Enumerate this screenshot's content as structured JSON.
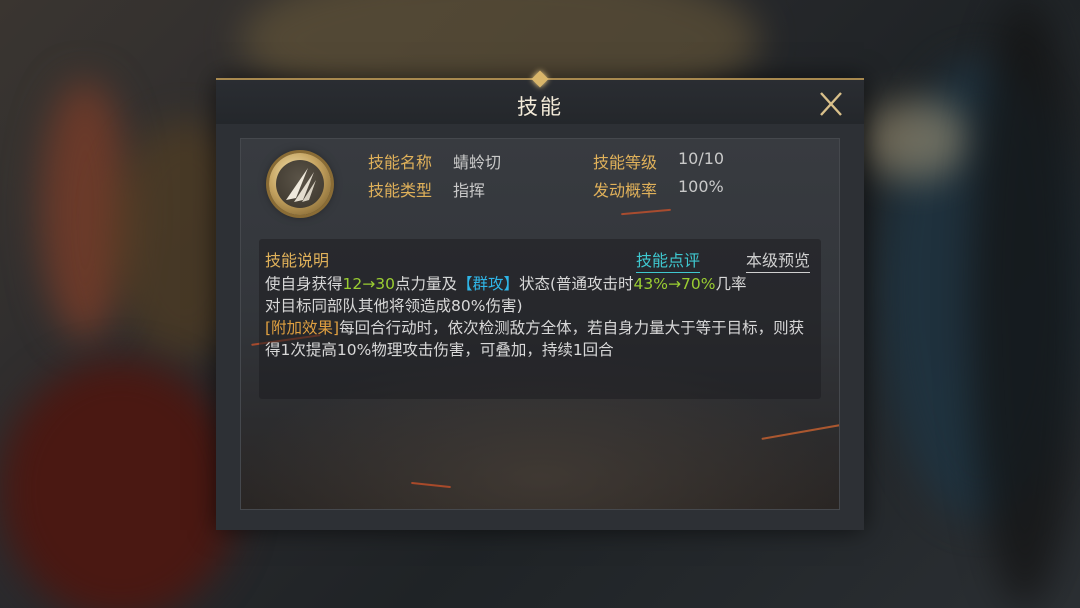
{
  "dialog": {
    "title": "技能"
  },
  "skill": {
    "name_label": "技能名称",
    "name_value": "蜻蛉切",
    "type_label": "技能类型",
    "type_value": "指挥",
    "level_label": "技能等级",
    "level_value": "10/10",
    "chance_label": "发动概率",
    "chance_value": "100%"
  },
  "description": {
    "title": "技能说明",
    "review_link": "技能点评",
    "preview_link": "本级预览",
    "line1": {
      "p1": "使自身获得",
      "v1": "12→30",
      "p2": "点力量及",
      "tag": "【群攻】",
      "p3": "状态(普通攻击时",
      "v2": "43%→70%",
      "p4": "几率"
    },
    "line2": "对目标同部队其他将领造成80%伤害)",
    "extra_tag": "[附加效果]",
    "extra_text": "每回合行动时，依次检测敌方全体，若自身力量大于等于目标，则获得1次提高10%物理攻击伤害，可叠加，持续1回合"
  },
  "icons": {
    "close": "close-icon",
    "skill": "claw-slash-icon"
  },
  "colors": {
    "label_gold": "#e0b15a",
    "highlight_green": "#9acd32",
    "highlight_cyan": "#2fb6e8",
    "link_cyan": "#3fc8d0"
  }
}
